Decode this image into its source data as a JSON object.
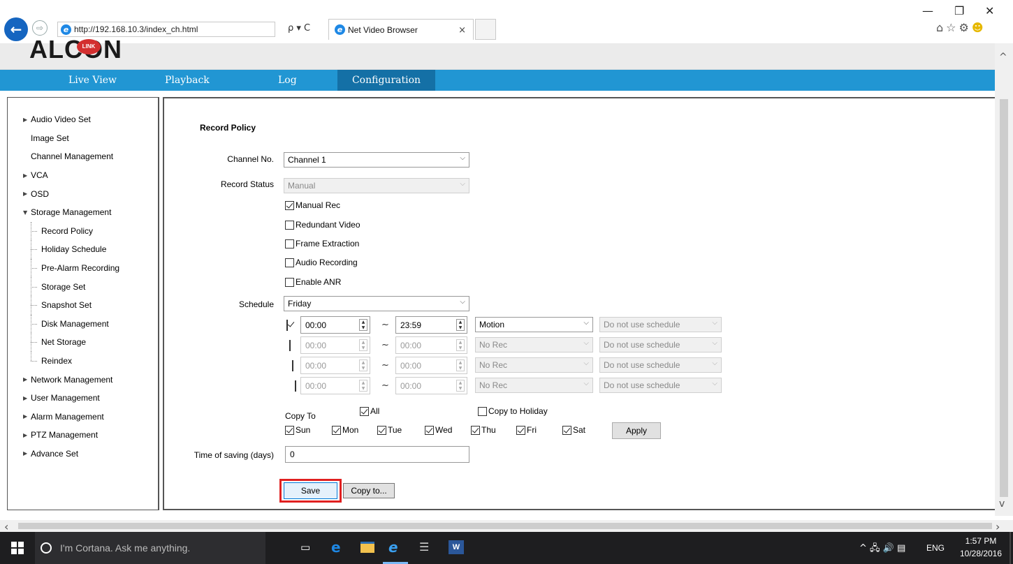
{
  "browser": {
    "address": "http://192.168.10.3/index_ch.html",
    "search_refresh": "ρ ▾ C",
    "tab_title": "Net Video Browser",
    "tab_close": "×",
    "window": {
      "minimize": "—",
      "restore": "❐",
      "close": "✕"
    },
    "fav_icons": "⌂☆⚙"
  },
  "app": {
    "logo": "ALCON",
    "logo_badge": "LINK",
    "nav": [
      "Live View",
      "Playback",
      "Log",
      "Configuration"
    ],
    "active_nav": "Configuration"
  },
  "sidebar": {
    "items": [
      {
        "label": "Audio Video Set",
        "level": 0,
        "arrow": "▶"
      },
      {
        "label": "Image Set",
        "level": 0,
        "arrow": ""
      },
      {
        "label": "Channel Management",
        "level": 0,
        "arrow": ""
      },
      {
        "label": "VCA",
        "level": 0,
        "arrow": "▶"
      },
      {
        "label": "OSD",
        "level": 0,
        "arrow": "▶"
      },
      {
        "label": "Storage Management",
        "level": 0,
        "arrow": "▼"
      },
      {
        "label": "Record Policy",
        "level": 1
      },
      {
        "label": "Holiday Schedule",
        "level": 1
      },
      {
        "label": "Pre-Alarm Recording",
        "level": 1
      },
      {
        "label": "Storage Set",
        "level": 1
      },
      {
        "label": "Snapshot Set",
        "level": 1
      },
      {
        "label": "Disk Management",
        "level": 1
      },
      {
        "label": "Net Storage",
        "level": 1
      },
      {
        "label": "Reindex",
        "level": 1
      },
      {
        "label": "Network Management",
        "level": 0,
        "arrow": "▶"
      },
      {
        "label": "User Management",
        "level": 0,
        "arrow": "▶"
      },
      {
        "label": "Alarm Management",
        "level": 0,
        "arrow": "▶"
      },
      {
        "label": "PTZ Management",
        "level": 0,
        "arrow": "▶"
      },
      {
        "label": "Advance Set",
        "level": 0,
        "arrow": "▶"
      }
    ]
  },
  "form": {
    "title": "Record Policy",
    "channel_label": "Channel No.",
    "channel_value": "Channel 1",
    "status_label": "Record Status",
    "status_value": "Manual",
    "options": {
      "manual_rec": {
        "label": "Manual Rec",
        "checked": true
      },
      "redundant": {
        "label": "Redundant Video",
        "checked": false
      },
      "frame": {
        "label": "Frame Extraction",
        "checked": false
      },
      "audio": {
        "label": "Audio Recording",
        "checked": false
      },
      "anr": {
        "label": "Enable ANR",
        "checked": false
      }
    },
    "schedule_label": "Schedule",
    "schedule_day": "Friday",
    "tilde": "~",
    "rows": [
      {
        "checked": true,
        "start": "00:00",
        "end": "23:59",
        "type": "Motion",
        "holiday": "Do not use schedule",
        "enabled": true
      },
      {
        "checked": false,
        "start": "00:00",
        "end": "00:00",
        "type": "No Rec",
        "holiday": "Do not use schedule",
        "enabled": false
      },
      {
        "checked": false,
        "start": "00:00",
        "end": "00:00",
        "type": "No Rec",
        "holiday": "Do not use schedule",
        "enabled": false
      },
      {
        "checked": false,
        "start": "00:00",
        "end": "00:00",
        "type": "No Rec",
        "holiday": "Do not use schedule",
        "enabled": false
      }
    ],
    "copy_to_label": "Copy To",
    "all_label": "All",
    "copy_holiday_label": "Copy to Holiday",
    "days": [
      "Sun",
      "Mon",
      "Tue",
      "Wed",
      "Thu",
      "Fri",
      "Sat"
    ],
    "apply_label": "Apply",
    "saving_label": "Time of saving (days)",
    "saving_value": "0",
    "save_label": "Save",
    "copy_label": "Copy to..."
  },
  "taskbar": {
    "cortana": "I'm Cortana. Ask me anything.",
    "word_letter": "W",
    "tray": "^ 🖧 🔊 ▤",
    "lang": "ENG",
    "time": "1:57 PM",
    "date": "10/28/2016"
  },
  "colors": {
    "nav_blue": "#2196d3",
    "nav_active": "#1470a6",
    "highlight_red": "#e02020"
  }
}
